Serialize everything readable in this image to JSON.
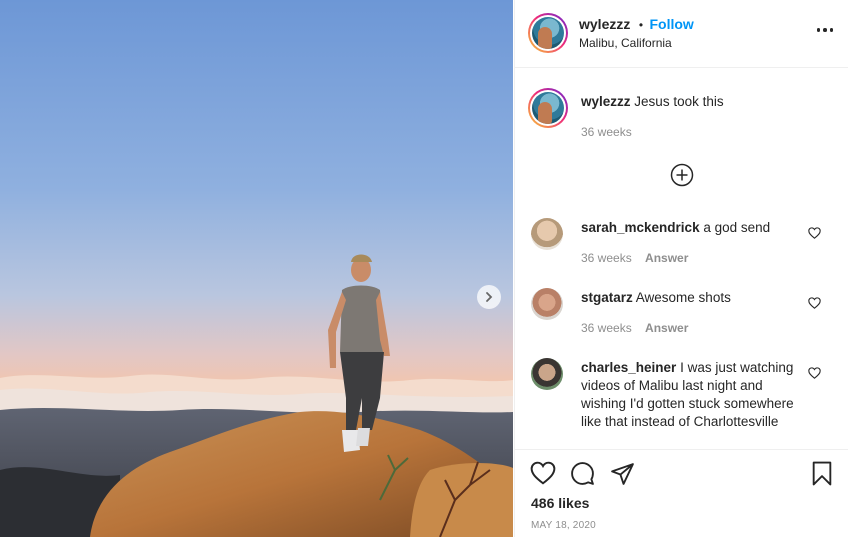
{
  "post": {
    "author": "wylezzz",
    "follow_label": "Follow",
    "separator": "•",
    "location": "Malibu, California",
    "caption": "Jesus took this",
    "caption_age": "36 weeks",
    "likes": "486 likes",
    "date": "MAY 18, 2020"
  },
  "comments": [
    {
      "user": "sarah_mckendrick",
      "text": "a god send",
      "age": "36 weeks",
      "reply_label": "Answer"
    },
    {
      "user": "stgatarz",
      "text": "Awesome shots",
      "age": "36 weeks",
      "reply_label": "Answer"
    },
    {
      "user": "charles_heiner",
      "text": "I was just watching videos of Malibu last night and wishing I'd gotten stuck somewhere like that instead of Charlottesville"
    }
  ],
  "icons": {
    "more": "more-options-icon",
    "next": "chevron-right-icon",
    "load_more": "plus-circle-icon",
    "like": "heart-icon",
    "comment": "comment-icon",
    "share": "paper-plane-icon",
    "save": "bookmark-icon"
  },
  "colors": {
    "accent": "#0095f6",
    "muted": "#8e8e8e",
    "text": "#262626"
  }
}
